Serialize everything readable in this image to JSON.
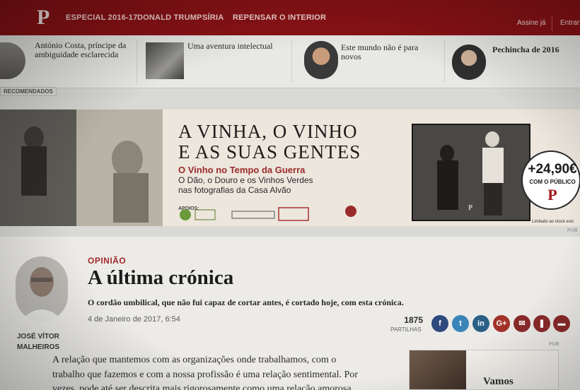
{
  "nav": {
    "logo": "P",
    "links": [
      "ESPECIAL 2016-17",
      "DONALD TRUMP",
      "SÍRIA",
      "REPENSAR O INTERIOR"
    ],
    "subscribe": "Assine já",
    "login": "Entrar"
  },
  "recommended": {
    "label": "RECOMENDADOS",
    "items": [
      {
        "title": "António Costa, príncipe da ambiguidade esclarecida"
      },
      {
        "title": "Uma aventura intelectual"
      },
      {
        "title": "Este mundo não é para novos"
      },
      {
        "title": "Pechincha de 2016"
      }
    ]
  },
  "ad": {
    "title_line1": "A VINHA, O VINHO",
    "title_line2": "E AS SUAS GENTES",
    "subtitle": "O Vinho no Tempo da Guerra",
    "line1": "O Dão, o Douro e os Vinhos Verdes",
    "line2": "nas fotografias da Casa Alvão",
    "apoios": "APOIOS:",
    "price": "+24,90€",
    "price_sub": "COM O PÚBLICO",
    "price_logo": "P",
    "stock_note": "Limitado ao stock exis",
    "pub": "PUB"
  },
  "article": {
    "section": "OPINIÃO",
    "headline": "A última crónica",
    "lede": "O cordão umbilical, que não fui capaz de cortar antes, é cortado hoje, com esta crónica.",
    "author_line1": "JOSÉ VÍTOR",
    "author_line2": "MALHEIROS",
    "date": "4 de Janeiro de 2017, 6:54",
    "share_count": "1875",
    "share_label": "PARTILHAS",
    "body_lines": [
      "A relação que mantemos com as organizações onde trabalhamos, com o",
      "trabalho que fazemos e com a nossa profissão é uma relação sentimental. Por",
      "vezes, pode até ser descrita mais rigorosamente como uma relação amorosa."
    ],
    "side_ad_pub": "PUB",
    "side_ad_text": "Vamos"
  },
  "share_buttons": [
    {
      "name": "facebook",
      "glyph": "f",
      "color": "#2f4a7e"
    },
    {
      "name": "twitter",
      "glyph": "t",
      "color": "#3a84b8"
    },
    {
      "name": "linkedin",
      "glyph": "in",
      "color": "#2a5f86"
    },
    {
      "name": "google-plus",
      "glyph": "G+",
      "color": "#a2322a"
    },
    {
      "name": "email",
      "glyph": "✉",
      "color": "#8a2a2a"
    },
    {
      "name": "bookmark",
      "glyph": "❚",
      "color": "#8a2a2a"
    },
    {
      "name": "comment",
      "glyph": "▬",
      "color": "#8a2a2a"
    }
  ]
}
